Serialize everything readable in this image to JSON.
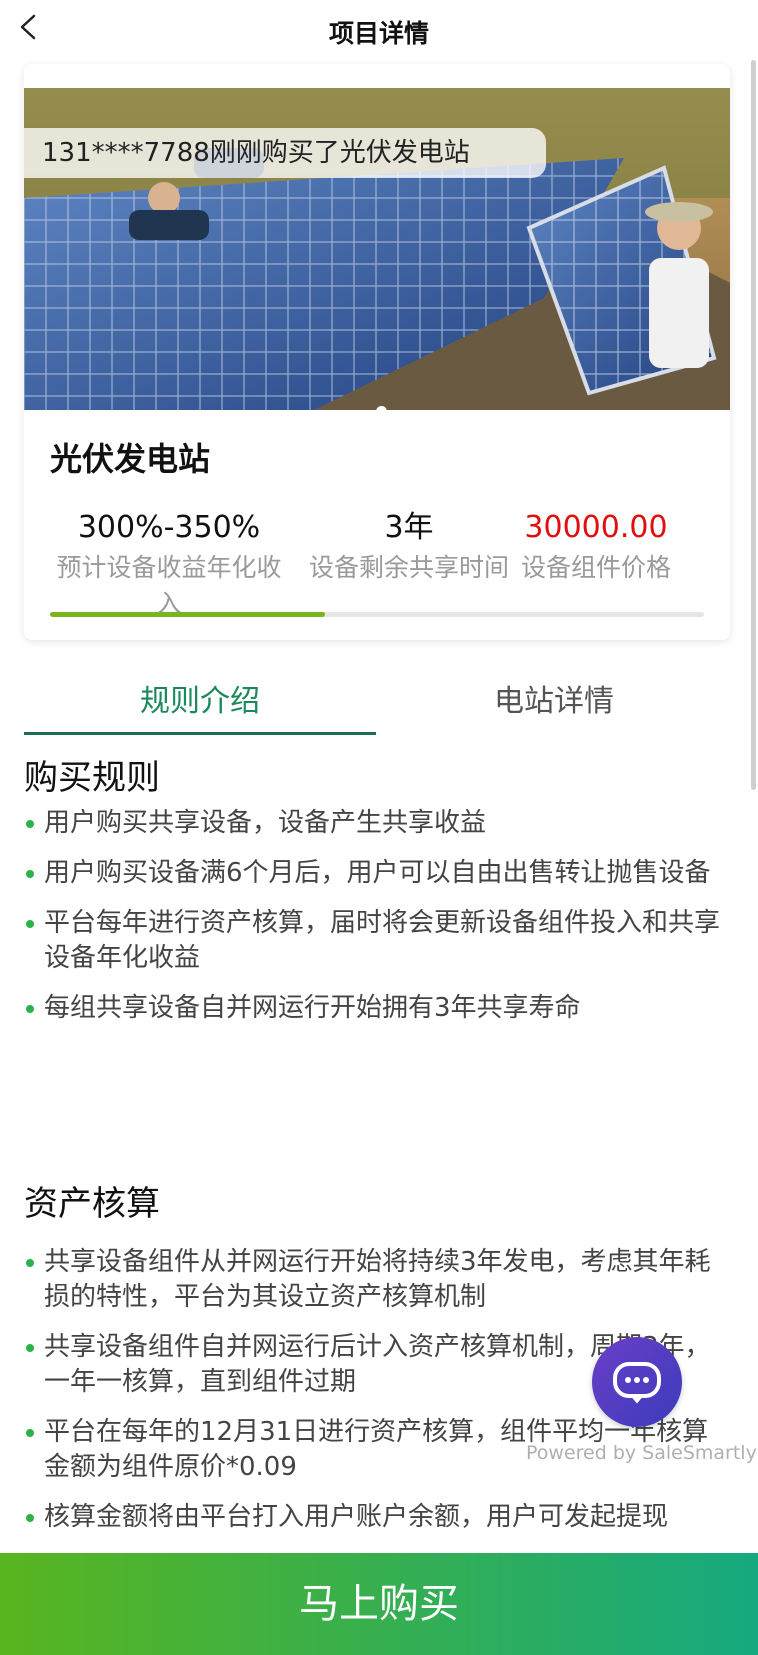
{
  "header": {
    "title": "项目详情"
  },
  "banner": {
    "notice": "131****7788刚刚购买了光伏发电站"
  },
  "project": {
    "name": "光伏发电站",
    "stats": [
      {
        "value": "300%-350%",
        "label": "预计设备收益年化收入"
      },
      {
        "value": "3年",
        "label": "设备剩余共享时间"
      },
      {
        "value": "30000.00",
        "label": "设备组件价格"
      }
    ],
    "progress": 0.42
  },
  "tabs": [
    {
      "label": "规则介绍",
      "active": true
    },
    {
      "label": "电站详情",
      "active": false
    }
  ],
  "sections": {
    "purchase": {
      "title": "购买规则",
      "items": [
        "用户购买共享设备，设备产生共享收益",
        "用户购买设备满6个月后，用户可以自由出售转让抛售设备",
        "平台每年进行资产核算，届时将会更新设备组件投入和共享设备年化收益",
        "每组共享设备自并网运行开始拥有3年共享寿命"
      ]
    },
    "accounting": {
      "title": "资产核算",
      "items": [
        "共享设备组件从并网运行开始将持续3年发电，考虑其年耗损的特性，平台为其设立资产核算机制",
        "共享设备组件自并网运行后计入资产核算机制，周期3年，一年一核算，直到组件过期",
        "平台在每年的12月31日进行资产核算，组件平均一年核算金额为组件原价*0.09",
        "核算金额将由平台打入用户账户余额，用户可发起提现"
      ]
    }
  },
  "chat": {
    "powered_by": "Powered by SaleSmartly"
  },
  "buy": {
    "label": "马上购买"
  },
  "colors": {
    "accent_green": "#1b8a5a",
    "price_red": "#e30d0d",
    "bullet_green": "#2db24a"
  }
}
